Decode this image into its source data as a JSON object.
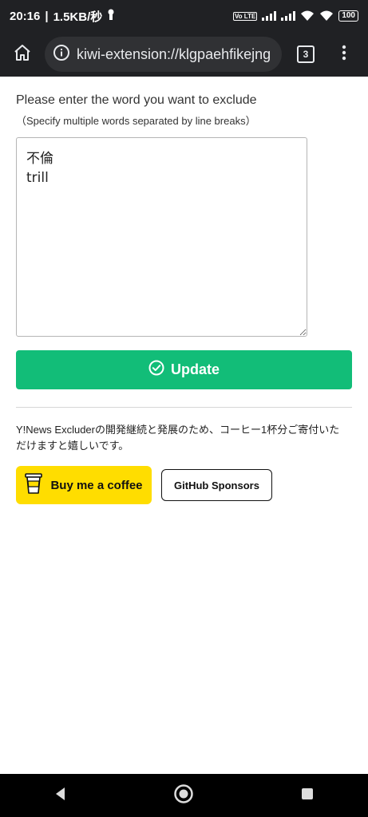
{
  "status_bar": {
    "time": "20:16",
    "separator": "|",
    "net_speed": "1.5KB/秒",
    "volte_label": "Vo LTE",
    "battery": "100"
  },
  "browser": {
    "url": "kiwi-extension://klgpaehfikejng",
    "tab_count": "3"
  },
  "form": {
    "prompt": "Please enter the word you want to exclude",
    "sub_prompt": "（Specify multiple words separated by line breaks）",
    "words_value": "不倫\ntrill",
    "update_label": "Update"
  },
  "support": {
    "text": "Y!News Excluderの開発継続と発展のため、コーヒー1杯分ご寄付いただけますと嬉しいです。",
    "bmc_label": "Buy me a coffee",
    "github_label": "GitHub Sponsors"
  },
  "colors": {
    "accent_green": "#12bd78",
    "bmc_yellow": "#ffdd00",
    "browser_dark": "#202124"
  }
}
